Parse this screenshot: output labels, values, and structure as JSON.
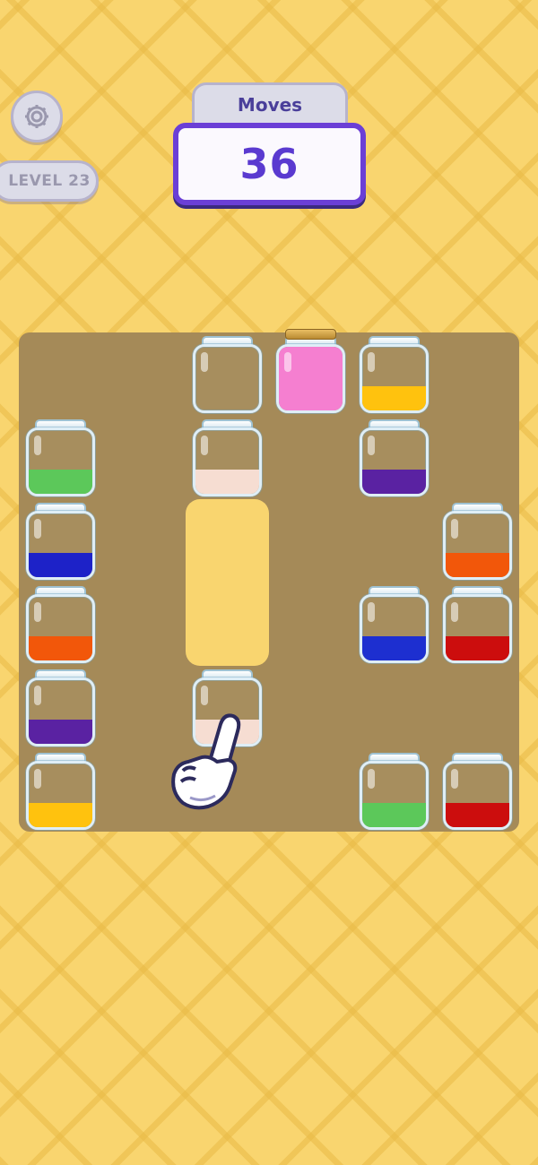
{
  "hud": {
    "settings_icon": "gear-icon",
    "level_label": "LEVEL 23",
    "moves_label": "Moves",
    "moves_value": "36"
  },
  "board": {
    "background_color": "#a58a58",
    "grid": {
      "columns": 6,
      "rows": 6
    },
    "jars": [
      {
        "id": "jar-r0-c2",
        "row": 0,
        "col": 2,
        "fill": 0,
        "color": null,
        "sealed": false
      },
      {
        "id": "jar-r0-c3",
        "row": 0,
        "col": 3,
        "fill": 1.0,
        "color": "#f57fd0",
        "sealed": true
      },
      {
        "id": "jar-r0-c4",
        "row": 0,
        "col": 4,
        "fill": 0.38,
        "color": "#ffc20e",
        "sealed": false
      },
      {
        "id": "jar-r1-c0",
        "row": 1,
        "col": 0,
        "fill": 0.38,
        "color": "#5cc85a",
        "sealed": false
      },
      {
        "id": "jar-r1-c2",
        "row": 1,
        "col": 2,
        "fill": 0.38,
        "color": "#f6ddd2",
        "sealed": false
      },
      {
        "id": "jar-r1-c4",
        "row": 1,
        "col": 4,
        "fill": 0.38,
        "color": "#5a22a2",
        "sealed": false
      },
      {
        "id": "jar-r2-c0",
        "row": 2,
        "col": 0,
        "fill": 0.38,
        "color": "#1d22c8",
        "sealed": false
      },
      {
        "id": "jar-r2-c5",
        "row": 2,
        "col": 5,
        "fill": 0.38,
        "color": "#f2570a",
        "sealed": false
      },
      {
        "id": "jar-r3-c0",
        "row": 3,
        "col": 0,
        "fill": 0.38,
        "color": "#f2570a",
        "sealed": false
      },
      {
        "id": "jar-r3-c4",
        "row": 3,
        "col": 4,
        "fill": 0.38,
        "color": "#1d2fd0",
        "sealed": false
      },
      {
        "id": "jar-r3-c5",
        "row": 3,
        "col": 5,
        "fill": 0.38,
        "color": "#cc0d0d",
        "sealed": false
      },
      {
        "id": "jar-r4-c0",
        "row": 4,
        "col": 0,
        "fill": 0.38,
        "color": "#5a22a2",
        "sealed": false
      },
      {
        "id": "jar-r4-c2",
        "row": 4,
        "col": 2,
        "fill": 0.38,
        "color": "#f6ddd2",
        "sealed": false
      },
      {
        "id": "jar-r5-c0",
        "row": 5,
        "col": 0,
        "fill": 0.38,
        "color": "#ffc20e",
        "sealed": false
      },
      {
        "id": "jar-r5-c4",
        "row": 5,
        "col": 4,
        "fill": 0.38,
        "color": "#5cc85a",
        "sealed": false
      },
      {
        "id": "jar-r5-c5",
        "row": 5,
        "col": 5,
        "fill": 0.38,
        "color": "#cc0d0d",
        "sealed": false
      }
    ]
  },
  "hint": {
    "icon": "pointing-hand-icon",
    "target": "jar-r4-c2"
  }
}
